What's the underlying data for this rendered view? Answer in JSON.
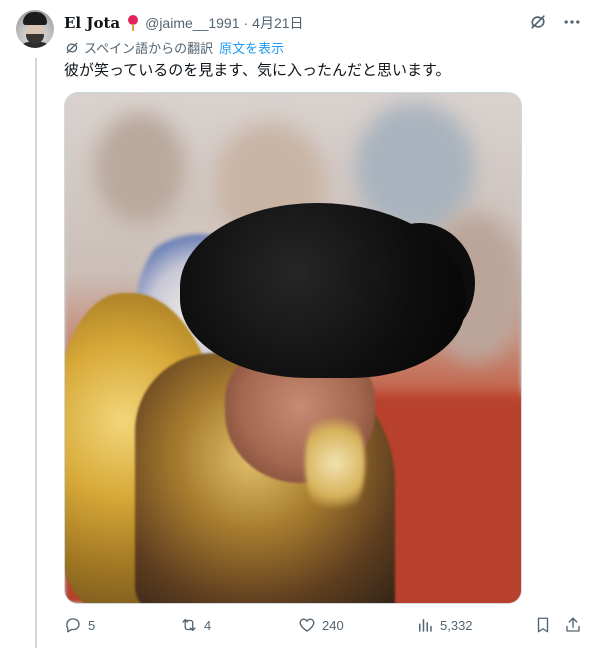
{
  "tweet": {
    "author_name": "El Jota",
    "handle": "@jaime__1991",
    "separator": "·",
    "date": "4月21日",
    "translated_label": "スペイン語からの翻訳",
    "show_original": "原文を表示",
    "text": "彼が笑っているのを見ます、気に入ったんだと思います。"
  },
  "actions": {
    "replies": "5",
    "retweets": "4",
    "likes": "240",
    "views": "5,332"
  },
  "icons": {
    "top": [
      "grok-icon",
      "more-icon"
    ],
    "translate": "translate-icon",
    "actions": [
      "reply-icon",
      "retweet-icon",
      "like-icon",
      "views-icon",
      "bookmark-icon",
      "share-icon"
    ],
    "emoji": "pushpin-emoji"
  },
  "colors": {
    "text": "#0f1419",
    "secondary": "#536471",
    "link": "#1d9bf0",
    "line": "#cfd9de"
  }
}
